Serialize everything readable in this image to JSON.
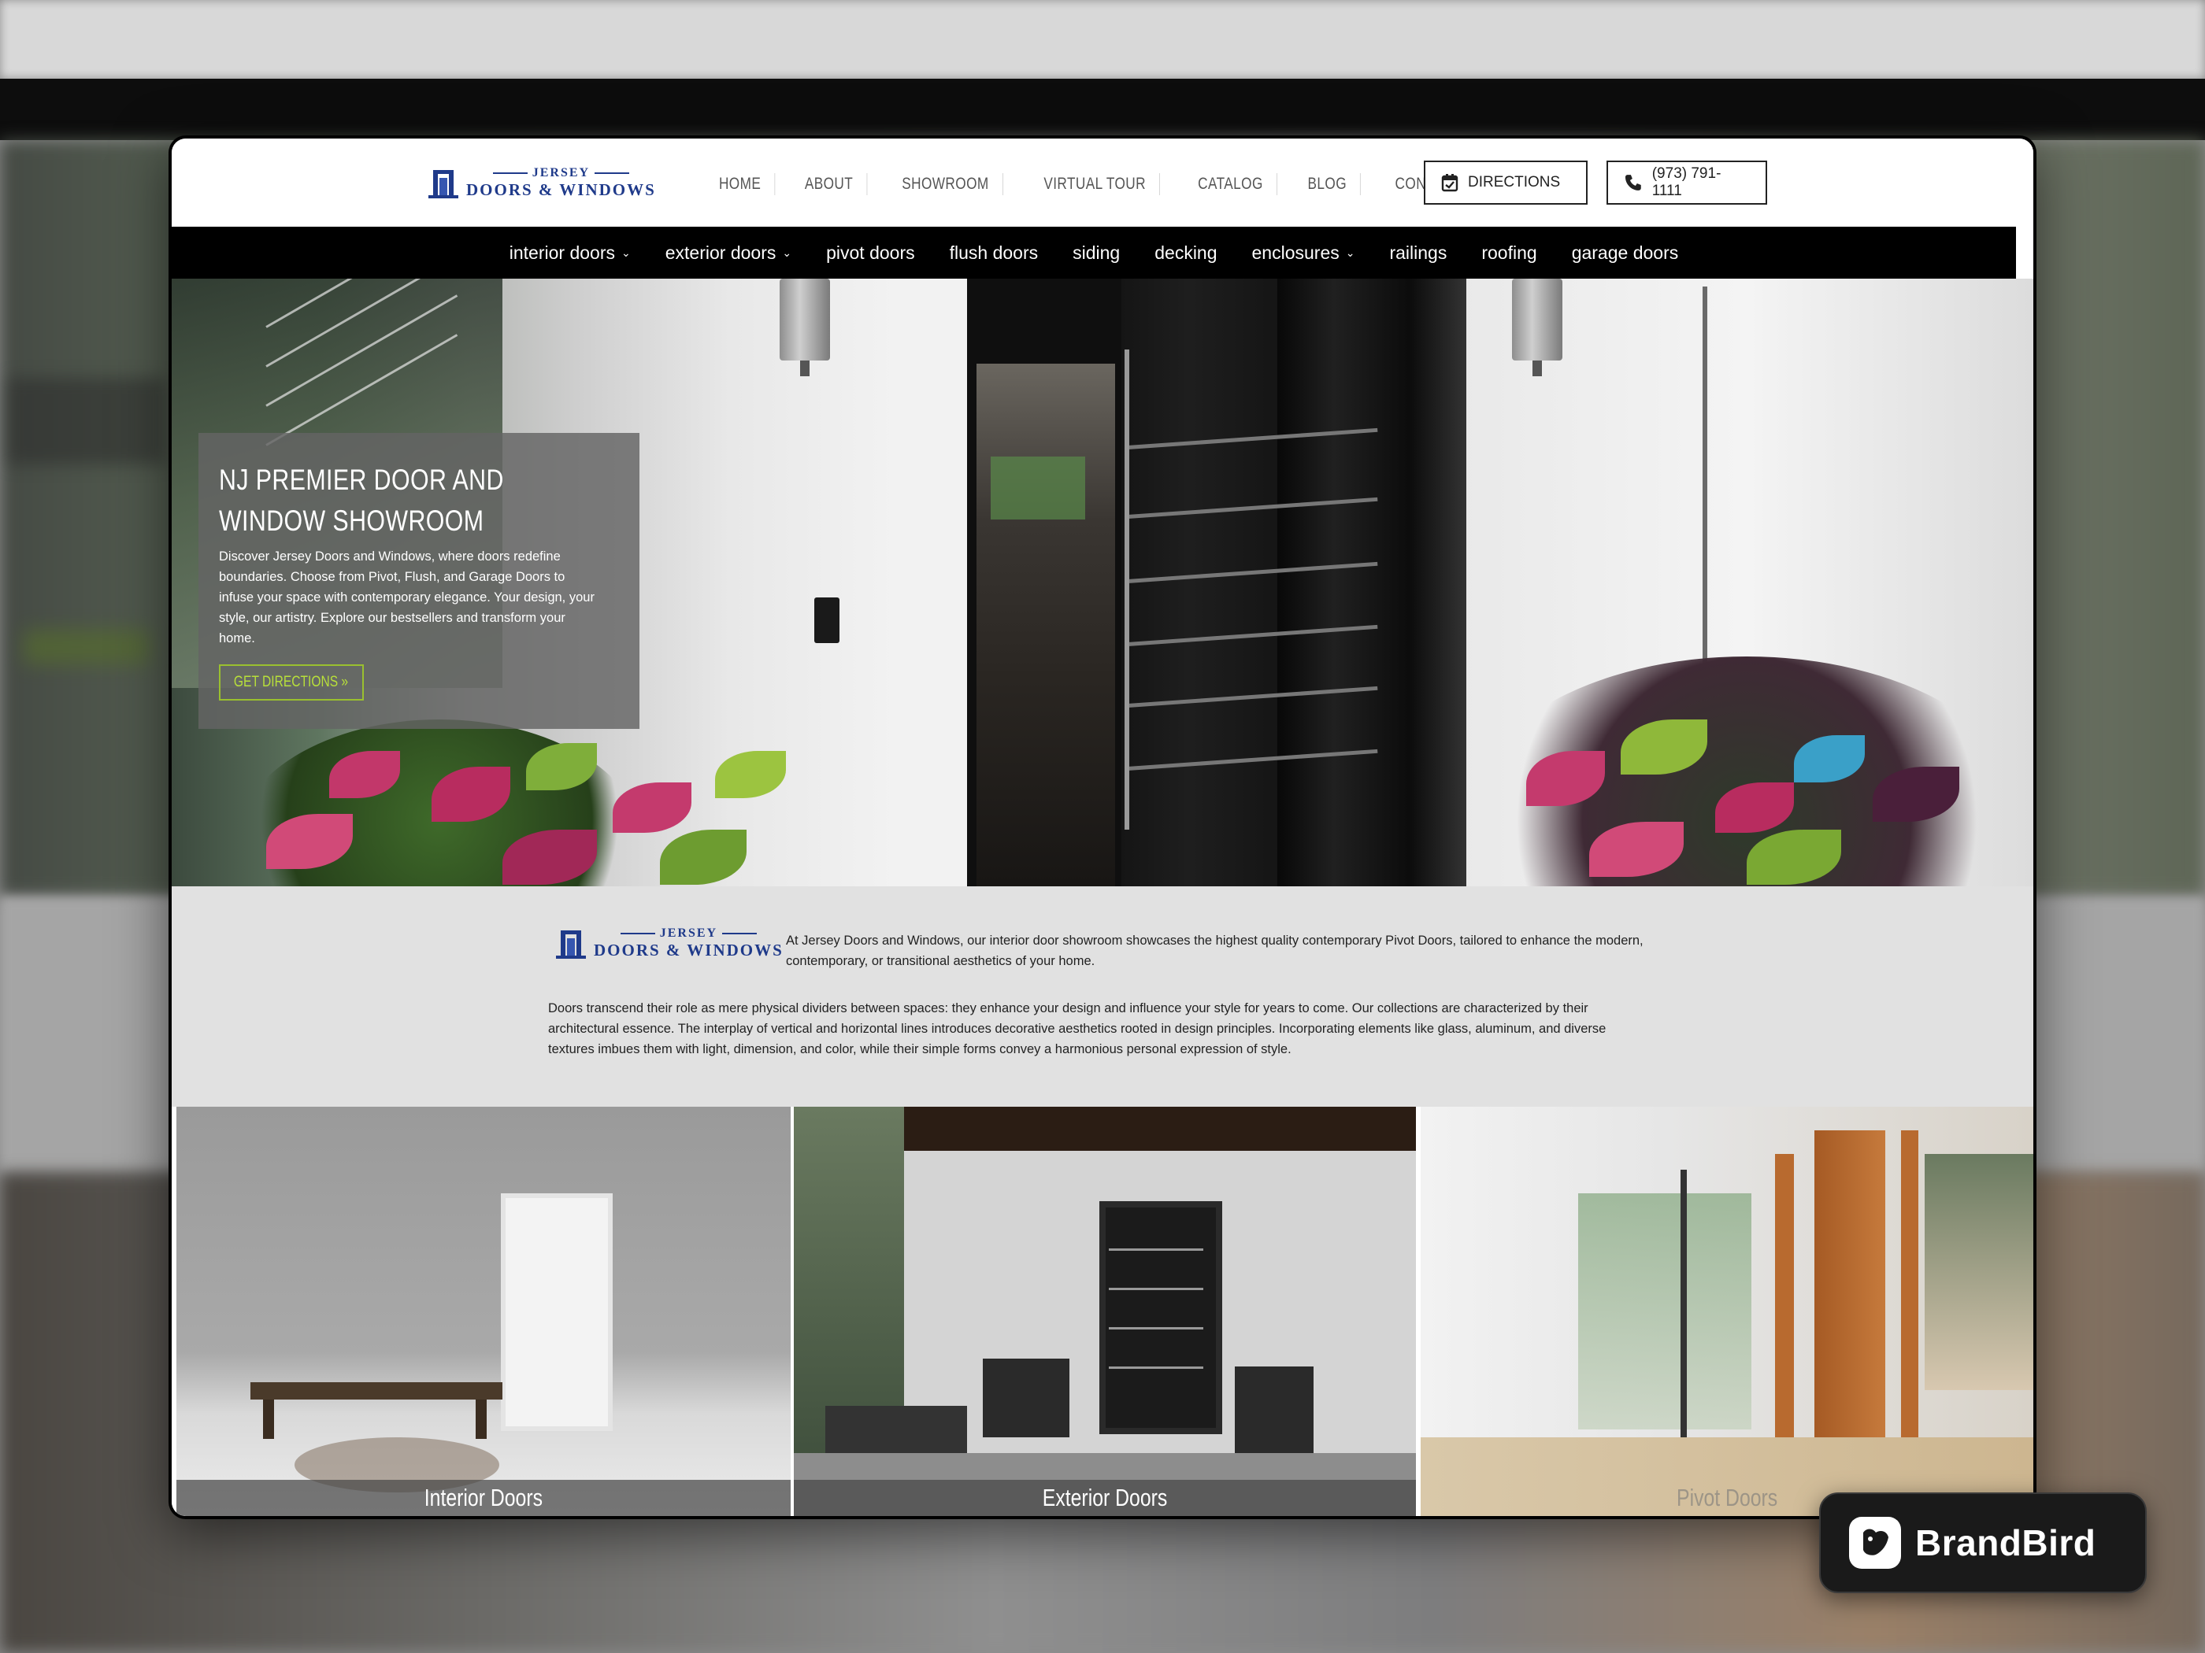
{
  "header": {
    "logo_top": "JERSEY",
    "logo_bottom": "DOORS & WINDOWS",
    "nav": [
      "HOME",
      "ABOUT",
      "SHOWROOM",
      "VIRTUAL TOUR",
      "CATALOG",
      "BLOG",
      "CONTACT US"
    ],
    "directions_label": "DIRECTIONS",
    "phone_label": "(973) 791-1111"
  },
  "categories": [
    {
      "label": "interior doors",
      "dropdown": true
    },
    {
      "label": "exterior doors",
      "dropdown": true
    },
    {
      "label": "pivot doors",
      "dropdown": false
    },
    {
      "label": "flush doors",
      "dropdown": false
    },
    {
      "label": "siding",
      "dropdown": false
    },
    {
      "label": "decking",
      "dropdown": false
    },
    {
      "label": "enclosures",
      "dropdown": true
    },
    {
      "label": "railings",
      "dropdown": false
    },
    {
      "label": "roofing",
      "dropdown": false
    },
    {
      "label": "garage doors",
      "dropdown": false
    }
  ],
  "hero": {
    "title": "NJ PREMIER DOOR AND WINDOW SHOWROOM",
    "body": "Discover Jersey Doors and Windows, where doors redefine boundaries. Choose from Pivot, Flush, and Garage Doors to infuse your space with contemporary elegance. Your design, your style, our artistry. Explore our bestsellers and transform your home.",
    "cta": "GET DIRECTIONS »"
  },
  "intro": {
    "logo_top": "JERSEY",
    "logo_bottom": "DOORS & WINDOWS",
    "paragraph1": "At Jersey Doors and Windows, our interior door showroom showcases the highest quality contemporary Pivot Doors, tailored to enhance the modern, contemporary, or transitional aesthetics of your home.",
    "paragraph2": "Doors transcend their role as mere physical dividers between spaces: they enhance your design and influence your style for years to come. Our collections are characterized by their architectural essence. The interplay of vertical and horizontal lines introduces decorative aesthetics rooted in design principles. Incorporating elements like glass, aluminum, and diverse textures imbues them with light, dimension, and color, while their simple forms convey a harmonious personal expression of style."
  },
  "tiles": [
    {
      "label": "Interior Doors"
    },
    {
      "label": "Exterior Doors"
    },
    {
      "label": "Pivot Doors"
    }
  ],
  "badge": {
    "label": "BrandBird"
  },
  "colors": {
    "brand_blue": "#1f3a8a",
    "cta_green": "#b8e03a",
    "nav_black": "#000000",
    "intro_bg": "#e1e1e1"
  }
}
